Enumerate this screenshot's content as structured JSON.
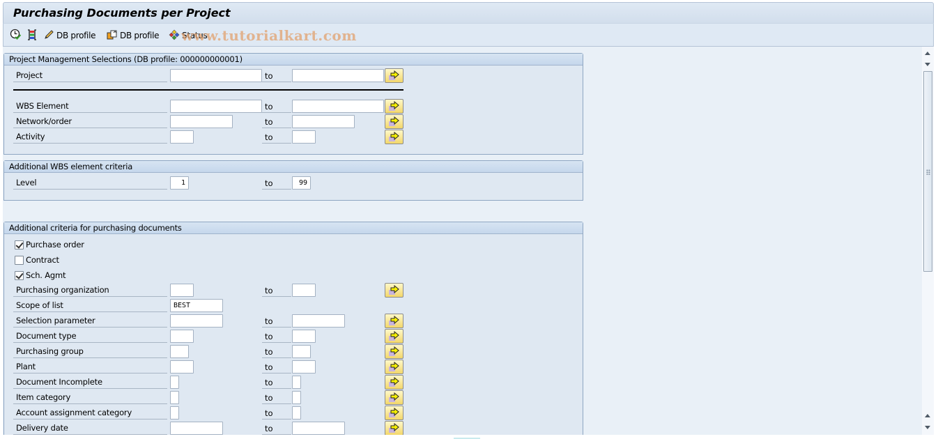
{
  "window": {
    "title": "Purchasing Documents per Project"
  },
  "toolbar": {
    "items": [
      {
        "icon": "execute-clock-icon",
        "label": ""
      },
      {
        "icon": "selection-options-icon",
        "label": ""
      },
      {
        "icon": "edit-pencil-icon",
        "label": "DB profile"
      },
      {
        "icon": "db-profile-copy-icon",
        "label": "DB profile"
      },
      {
        "icon": "status-icon",
        "label": "Status"
      }
    ],
    "watermark": "www.tutorialkart.com"
  },
  "groups": {
    "project_mgmt": {
      "title": "Project Management Selections (DB profile: 000000000001)",
      "rows": [
        {
          "label": "Project",
          "from": "",
          "to_label": "to",
          "to": ""
        },
        {
          "label": "WBS Element",
          "from": "",
          "to_label": "to",
          "to": ""
        },
        {
          "label": "Network/order",
          "from": "",
          "to_label": "to",
          "to": ""
        },
        {
          "label": "Activity",
          "from": "",
          "to_label": "to",
          "to": ""
        }
      ]
    },
    "wbs_criteria": {
      "title": "Additional WBS element criteria",
      "rows": [
        {
          "label": "Level",
          "from": "1",
          "to_label": "to",
          "to": "99"
        }
      ]
    },
    "purchasing": {
      "title": "Additional criteria for purchasing documents",
      "checkboxes": [
        {
          "label": "Purchase order",
          "checked": true
        },
        {
          "label": "Contract",
          "checked": false
        },
        {
          "label": "Sch. Agmt",
          "checked": true
        }
      ],
      "rows": [
        {
          "label": "Purchasing organization",
          "from": "",
          "to_label": "to",
          "to": ""
        },
        {
          "label": "Scope of list",
          "from": "BEST"
        },
        {
          "label": "Selection parameter",
          "from": "",
          "to_label": "to",
          "to": ""
        },
        {
          "label": "Document type",
          "from": "",
          "to_label": "to",
          "to": ""
        },
        {
          "label": "Purchasing group",
          "from": "",
          "to_label": "to",
          "to": ""
        },
        {
          "label": "Plant",
          "from": "",
          "to_label": "to",
          "to": ""
        },
        {
          "label": "Document Incomplete",
          "from": "",
          "to_label": "to",
          "to": ""
        },
        {
          "label": "Item category",
          "from": "",
          "to_label": "to",
          "to": ""
        },
        {
          "label": "Account assignment category",
          "from": "",
          "to_label": "to",
          "to": ""
        },
        {
          "label": "Delivery date",
          "from": "",
          "to_label": "to",
          "to": ""
        }
      ]
    }
  },
  "colors": {
    "background": "#e9f0f7",
    "group_header": "#c5d7ec",
    "multi_select_button": "#f3d76b",
    "watermark": "#e2a06e"
  }
}
